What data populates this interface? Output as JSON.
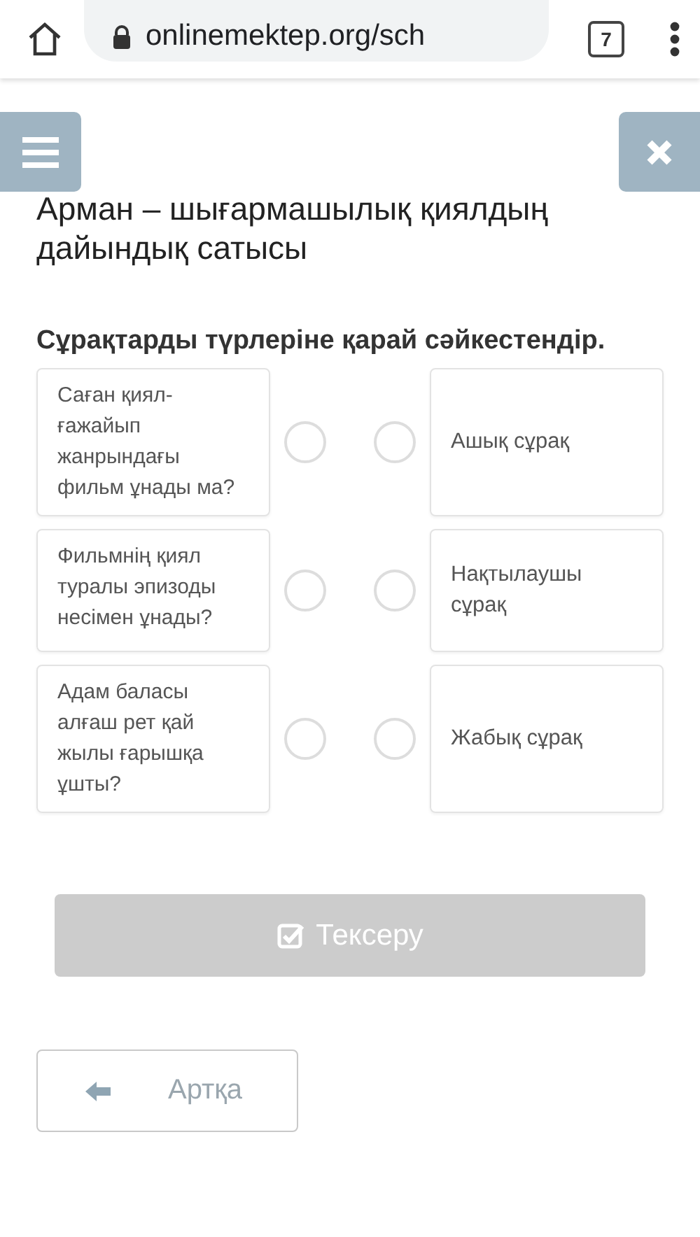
{
  "browser": {
    "url": "onlinemektep.org/sch",
    "tab_count": "7"
  },
  "title": "Арман – шығармашылық қиялдың дайындық сатысы",
  "question": "Сұрақтарды түрлеріне қарай сәйкестендір.",
  "pairs": [
    {
      "left": "Саған қиял-ғажайып жанрындағы фильм ұнады ма?",
      "right": "Ашық сұрақ",
      "left_selected": false,
      "right_selected": false
    },
    {
      "left": "Фильмнің қиял туралы эпизоды несімен ұнады?",
      "right": "Нақтылаушы сұрақ",
      "left_selected": false,
      "right_selected": false
    },
    {
      "left": "Адам баласы алғаш рет қай жылы ғарышқа ұшты?",
      "right": "Жабық сұрақ",
      "left_selected": false,
      "right_selected": false
    }
  ],
  "check_button": {
    "label": "Тексеру",
    "disabled": true
  },
  "back_button": {
    "label": "Артқа"
  }
}
